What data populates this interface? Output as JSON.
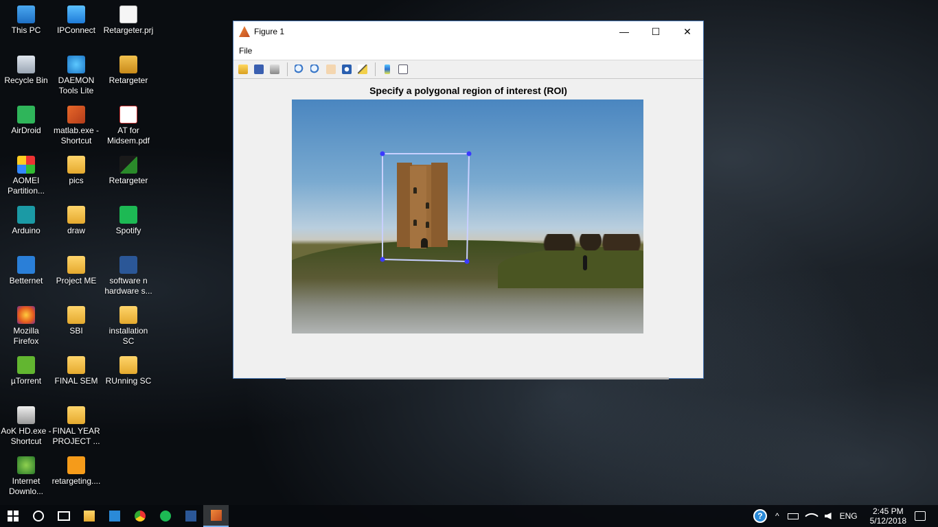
{
  "desktop": {
    "icons": [
      {
        "label": "This PC"
      },
      {
        "label": "IPConnect"
      },
      {
        "label": "Retargeter.prj"
      },
      {
        "label": "Recycle Bin"
      },
      {
        "label": "DAEMON Tools Lite"
      },
      {
        "label": "Retargeter"
      },
      {
        "label": "AirDroid"
      },
      {
        "label": "matlab.exe - Shortcut"
      },
      {
        "label": "AT for Midsem.pdf"
      },
      {
        "label": "AOMEI Partition..."
      },
      {
        "label": "pics"
      },
      {
        "label": "Retargeter"
      },
      {
        "label": "Arduino"
      },
      {
        "label": "draw"
      },
      {
        "label": "Spotify"
      },
      {
        "label": "Betternet"
      },
      {
        "label": "Project ME"
      },
      {
        "label": "software n hardware s..."
      },
      {
        "label": "Mozilla Firefox"
      },
      {
        "label": "SBI"
      },
      {
        "label": "installation SC"
      },
      {
        "label": "µTorrent"
      },
      {
        "label": "FINAL SEM"
      },
      {
        "label": "RUnning SC"
      },
      {
        "label": "AoK HD.exe - Shortcut"
      },
      {
        "label": "FINAL YEAR PROJECT ..."
      },
      {
        "label": "Internet Downlo..."
      },
      {
        "label": "retargeting...."
      }
    ]
  },
  "window": {
    "title": "Figure 1",
    "controls": {
      "minimize": "—",
      "maximize": "☐",
      "close": "✕"
    },
    "menu": [
      "File"
    ],
    "toolbar_icons": [
      "open-icon",
      "save-icon",
      "print-icon",
      "zoom-in-icon",
      "zoom-out-icon",
      "pan-icon",
      "rotate-3d-icon",
      "data-cursor-icon",
      "colorbar-icon",
      "legend-icon"
    ],
    "plot_title": "Specify a polygonal region of interest (ROI)"
  },
  "taskbar": {
    "apps": [
      "start-icon",
      "cortana-icon",
      "task-view-icon",
      "file-explorer-icon",
      "control-panel-icon",
      "chrome-icon",
      "spotify-icon",
      "word-icon",
      "matlab-icon"
    ],
    "tray": {
      "help": "?",
      "chevron": "^",
      "language": "ENG",
      "time": "2:45 PM",
      "date": "5/12/2018"
    }
  },
  "colors": {
    "accent": "#4a7ab8",
    "roi_line": "#c9d0ff",
    "roi_vertex": "#3a3aff"
  }
}
